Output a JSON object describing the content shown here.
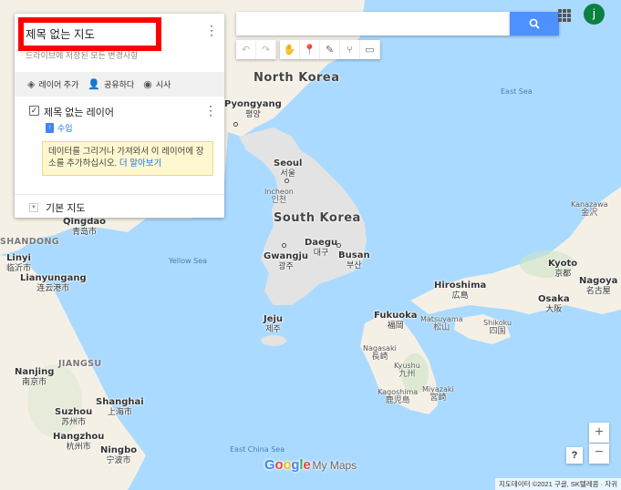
{
  "panel": {
    "map_title": "제목 없는 지도",
    "map_description": "드라이브에 저장된 모든 변경사항",
    "toolbar": {
      "add_layer": "레이어 추가",
      "share": "공유하다",
      "preview": "시사"
    },
    "layer": {
      "name": "제목 없는 레이어",
      "checked": true,
      "import_label": "수입",
      "hint_text": "데이터를 그리거나 가져와서 이 레이어에 장소를 추가하십시오. ",
      "hint_link": "더 알아보기"
    },
    "base_map_label": "기본 지도"
  },
  "search": {
    "placeholder": "",
    "value": ""
  },
  "user": {
    "avatar_letter": "j"
  },
  "map_labels": {
    "countries": {
      "north_korea": "North Korea",
      "south_korea": "South Korea"
    },
    "regions": {
      "shandong": "SHANDONG",
      "jiangsu": "JIANGSU"
    },
    "seas": {
      "east_sea": "East Sea",
      "yellow_sea": "Yellow Sea",
      "east_china_sea": "East China Sea"
    },
    "cities": {
      "pyongyang": {
        "en": "Pyongyang",
        "ko": "평양"
      },
      "seoul": {
        "en": "Seoul",
        "ko": "서울"
      },
      "incheon": {
        "en": "Incheon",
        "ko": "인천"
      },
      "daegu": {
        "en": "Daegu",
        "ko": "대구"
      },
      "gwangju": {
        "en": "Gwangju",
        "ko": "광주"
      },
      "busan": {
        "en": "Busan",
        "ko": "부산"
      },
      "jeju": {
        "en": "Jeju",
        "ko": "제주"
      },
      "qingdao": {
        "en": "Qingdao",
        "ko": "青岛市"
      },
      "linyi": {
        "en": "Linyi",
        "ko": "临沂市"
      },
      "lianyungang": {
        "en": "Lianyungang",
        "ko": "连云港市"
      },
      "nanjing": {
        "en": "Nanjing",
        "ko": "南京市"
      },
      "suzhou": {
        "en": "Suzhou",
        "ko": "苏州市"
      },
      "shanghai": {
        "en": "Shanghai",
        "ko": "上海市"
      },
      "hangzhou": {
        "en": "Hangzhou",
        "ko": "杭州市"
      },
      "ningbo": {
        "en": "Ningbo",
        "ko": "宁波市"
      },
      "hiroshima": {
        "en": "Hiroshima",
        "ko": "広島"
      },
      "fukuoka": {
        "en": "Fukuoka",
        "ko": "福岡"
      },
      "matsuyama": {
        "en": "Matsuyama",
        "ko": "松山"
      },
      "kyushu": {
        "en": "Kyushu",
        "ko": "九州"
      },
      "shikoku": {
        "en": "Shikoku",
        "ko": "四国"
      },
      "nagasaki": {
        "en": "Nagasaki",
        "ko": "長崎"
      },
      "kagoshima": {
        "en": "Kagoshima",
        "ko": "鹿児島"
      },
      "miyazaki": {
        "en": "Miyazaki",
        "ko": "宮崎"
      },
      "kyoto": {
        "en": "Kyoto",
        "ko": "京都"
      },
      "osaka": {
        "en": "Osaka",
        "ko": "大阪"
      },
      "nagoya": {
        "en": "Nagoya",
        "ko": "名古屋"
      },
      "kanazawa": {
        "en": "Kanazawa",
        "ko": "金沢"
      }
    }
  },
  "logo": {
    "google": "Google",
    "product": "My Maps"
  },
  "attribution": "지도데이터 ©2021 구글, SK텔레콤 · 자귀",
  "colors": {
    "water": "#aadaff",
    "land": "#f5f0e6",
    "korea": "#e3e3e3",
    "search_button": "#4d90fe",
    "avatar": "#0b8043",
    "highlight": "#ff0000"
  }
}
